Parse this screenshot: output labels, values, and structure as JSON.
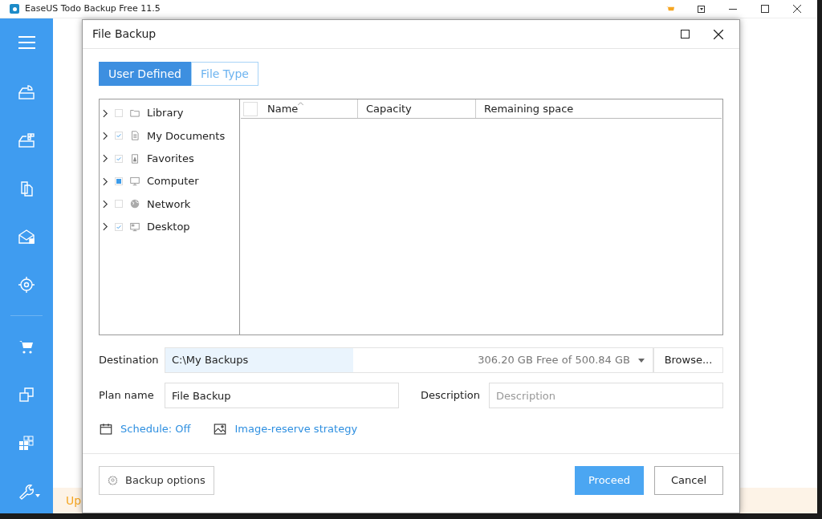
{
  "window": {
    "title": "EaseUS Todo Backup Free 11.5"
  },
  "status_strip": {
    "text": "Up"
  },
  "dialog": {
    "title": "File Backup",
    "tabs": [
      {
        "label": "User Defined",
        "selected": true
      },
      {
        "label": "File Type",
        "selected": false
      }
    ],
    "tree": [
      {
        "label": "Library",
        "checked": false,
        "kind": "folder"
      },
      {
        "label": "My Documents",
        "checked": true,
        "kind": "document"
      },
      {
        "label": "Favorites",
        "checked": true,
        "kind": "favorites"
      },
      {
        "label": "Computer",
        "partial": true,
        "kind": "computer"
      },
      {
        "label": "Network",
        "checked": false,
        "kind": "network"
      },
      {
        "label": "Desktop",
        "checked": true,
        "kind": "desktop"
      }
    ],
    "table": {
      "columns": [
        "Name",
        "Capacity",
        "Remaining space"
      ],
      "select_all_checked": false
    },
    "destination": {
      "label": "Destination",
      "value": "C:\\My Backups",
      "free": "306.20 GB Free of 500.84 GB",
      "browse": "Browse..."
    },
    "plan_name": {
      "label": "Plan name",
      "value": "File Backup"
    },
    "description": {
      "label": "Description",
      "placeholder": "Description"
    },
    "links": [
      {
        "label": "Schedule: Off",
        "kind": "calendar"
      },
      {
        "label": "Image-reserve strategy",
        "kind": "image"
      }
    ],
    "buttons": {
      "options": "Backup options",
      "proceed": "Proceed",
      "cancel": "Cancel"
    }
  }
}
